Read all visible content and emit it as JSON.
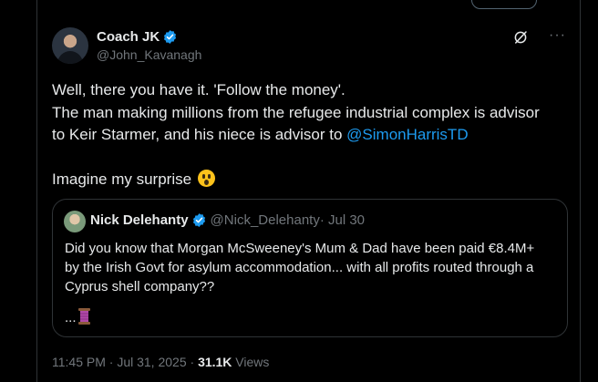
{
  "post": {
    "author": {
      "display_name": "Coach JK",
      "handle": "@John_Kavanagh"
    },
    "text_lines": [
      "Well, there you have it. 'Follow the money'.",
      "The man making millions from the refugee industrial complex is advisor",
      "to Keir Starmer, and his niece is advisor to "
    ],
    "mention": "@SimonHarrisTD",
    "final_line": "Imagine my surprise",
    "emoji": "face-with-open-mouth-icon",
    "more_label": "···"
  },
  "quote": {
    "author": {
      "display_name": "Nick Delehanty",
      "handle": "@Nick_Delehanty",
      "date": " · Jul 30"
    },
    "text_lines": [
      "Did you know that Morgan McSweeney's Mum & Dad have been paid €8.4M+",
      "by the Irish Govt for asylum accommodation... with all profits routed through a",
      "Cyprus shell company??"
    ],
    "ellipsis": "...",
    "thread_icon": "spool-of-thread-icon"
  },
  "footer": {
    "time": "11:45 PM · Jul 31, 2025 · ",
    "views_count": "31.1K",
    "views_label": " Views"
  },
  "colors": {
    "background": "#000000",
    "text": "#e7e9ea",
    "muted": "#71767b",
    "link": "#1d9bf0",
    "border": "#2f3336",
    "verified": "#1d9bf0"
  }
}
